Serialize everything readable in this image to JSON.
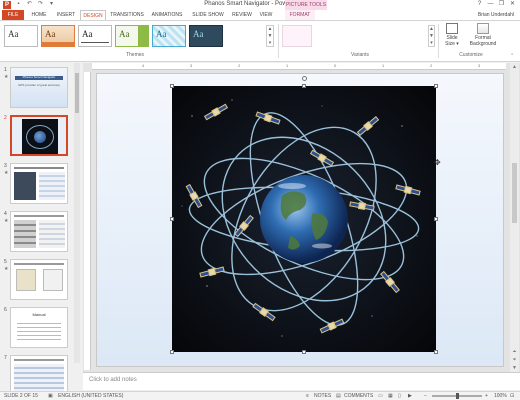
{
  "title_bar": {
    "app_title": "Phanos Smart Navigator - PowerPoint",
    "context_header": "PICTURE TOOLS",
    "app_icon": "P",
    "controls": [
      "?",
      "—",
      "❐",
      "✕"
    ]
  },
  "tabs": {
    "file": "FILE",
    "home": "HOME",
    "insert": "INSERT",
    "design": "DESIGN",
    "transitions": "TRANSITIONS",
    "animations": "ANIMATIONS",
    "slideshow": "SLIDE SHOW",
    "review": "REVIEW",
    "view": "VIEW",
    "format": "FORMAT",
    "user": "Brian Underdahl"
  },
  "ribbon": {
    "themes_label": "Themes",
    "variants_label": "Variants",
    "customize_label": "Customize",
    "theme_sample": "Aa",
    "slide_size_line1": "Slide",
    "slide_size_line2": "Size ▾",
    "format_bg_line1": "Format",
    "format_bg_line2": "Background"
  },
  "thumbnails": {
    "numbers": [
      "1",
      "2",
      "3",
      "4",
      "5",
      "6",
      "7"
    ],
    "thumb1_title": "Phanos Smart Navigator",
    "thumb1_sub": "GPS provider of great accuracy",
    "thumb6_title": "Manual"
  },
  "ruler": {
    "marks": [
      "4",
      "3",
      "2",
      "1",
      "0",
      "1",
      "2",
      "3",
      "4"
    ]
  },
  "notes": {
    "placeholder": "Click to add notes"
  },
  "status": {
    "slide": "SLIDE 2 OF 15",
    "language": "ENGLISH (UNITED STATES)",
    "notes": "NOTES",
    "comments": "COMMENTS",
    "zoom": "100%"
  },
  "colors": {
    "accent": "#d24726",
    "context_pink": "#a23a6e"
  }
}
